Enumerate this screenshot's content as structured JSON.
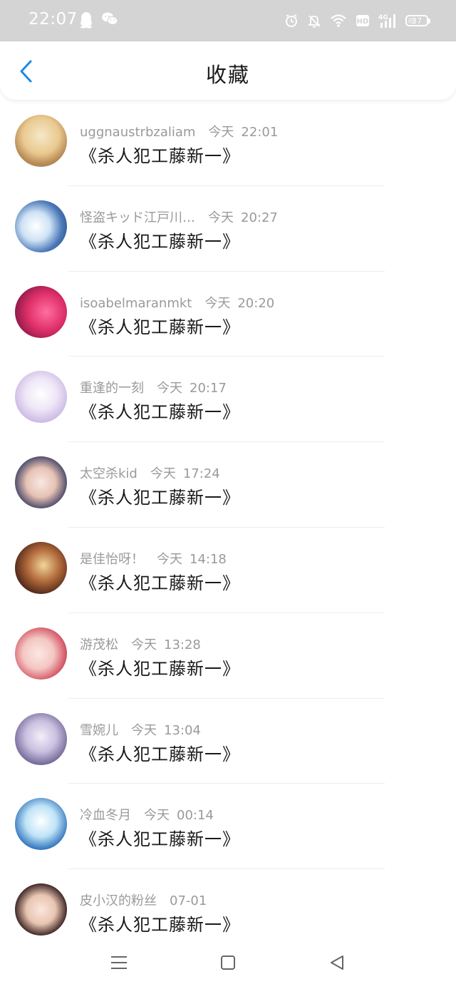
{
  "status_bar": {
    "time": "22:07",
    "app_icons": [
      "qq-icon",
      "wechat-icon"
    ],
    "right_icons": [
      "alarm-icon",
      "mute-icon",
      "wifi-icon",
      "hd-icon",
      "signal-4g-icon"
    ],
    "hd_label": "HD",
    "network_label": "4G",
    "battery_level": 37,
    "battery_text": "37"
  },
  "header": {
    "title": "收藏",
    "accent_color": "#1e8ae6"
  },
  "favorites": [
    {
      "username": "uggnaustrbzaliam",
      "date": "今天",
      "time": "22:01",
      "title": "《杀人犯工藤新一》"
    },
    {
      "username": "怪盗キッド江戸川…",
      "date": "今天",
      "time": "20:27",
      "title": "《杀人犯工藤新一》"
    },
    {
      "username": "isoabelmaranmkt",
      "date": "今天",
      "time": "20:20",
      "title": "《杀人犯工藤新一》"
    },
    {
      "username": "重逢的一刻",
      "date": "今天",
      "time": "20:17",
      "title": "《杀人犯工藤新一》"
    },
    {
      "username": "太空杀kid",
      "date": "今天",
      "time": "17:24",
      "title": "《杀人犯工藤新一》"
    },
    {
      "username": "是佳怡呀！",
      "date": "今天",
      "time": "14:18",
      "title": "《杀人犯工藤新一》"
    },
    {
      "username": "游茂松",
      "date": "今天",
      "time": "13:28",
      "title": "《杀人犯工藤新一》"
    },
    {
      "username": "雪婉儿",
      "date": "今天",
      "time": "13:04",
      "title": "《杀人犯工藤新一》"
    },
    {
      "username": "冷血冬月",
      "date": "今天",
      "time": "00:14",
      "title": "《杀人犯工藤新一》"
    },
    {
      "username": "皮小汉的粉丝",
      "date": "",
      "time": "07-01",
      "title": "《杀人犯工藤新一》"
    }
  ],
  "nav_bar": {
    "buttons": [
      "menu-icon",
      "home-icon",
      "back-triangle-icon"
    ]
  }
}
